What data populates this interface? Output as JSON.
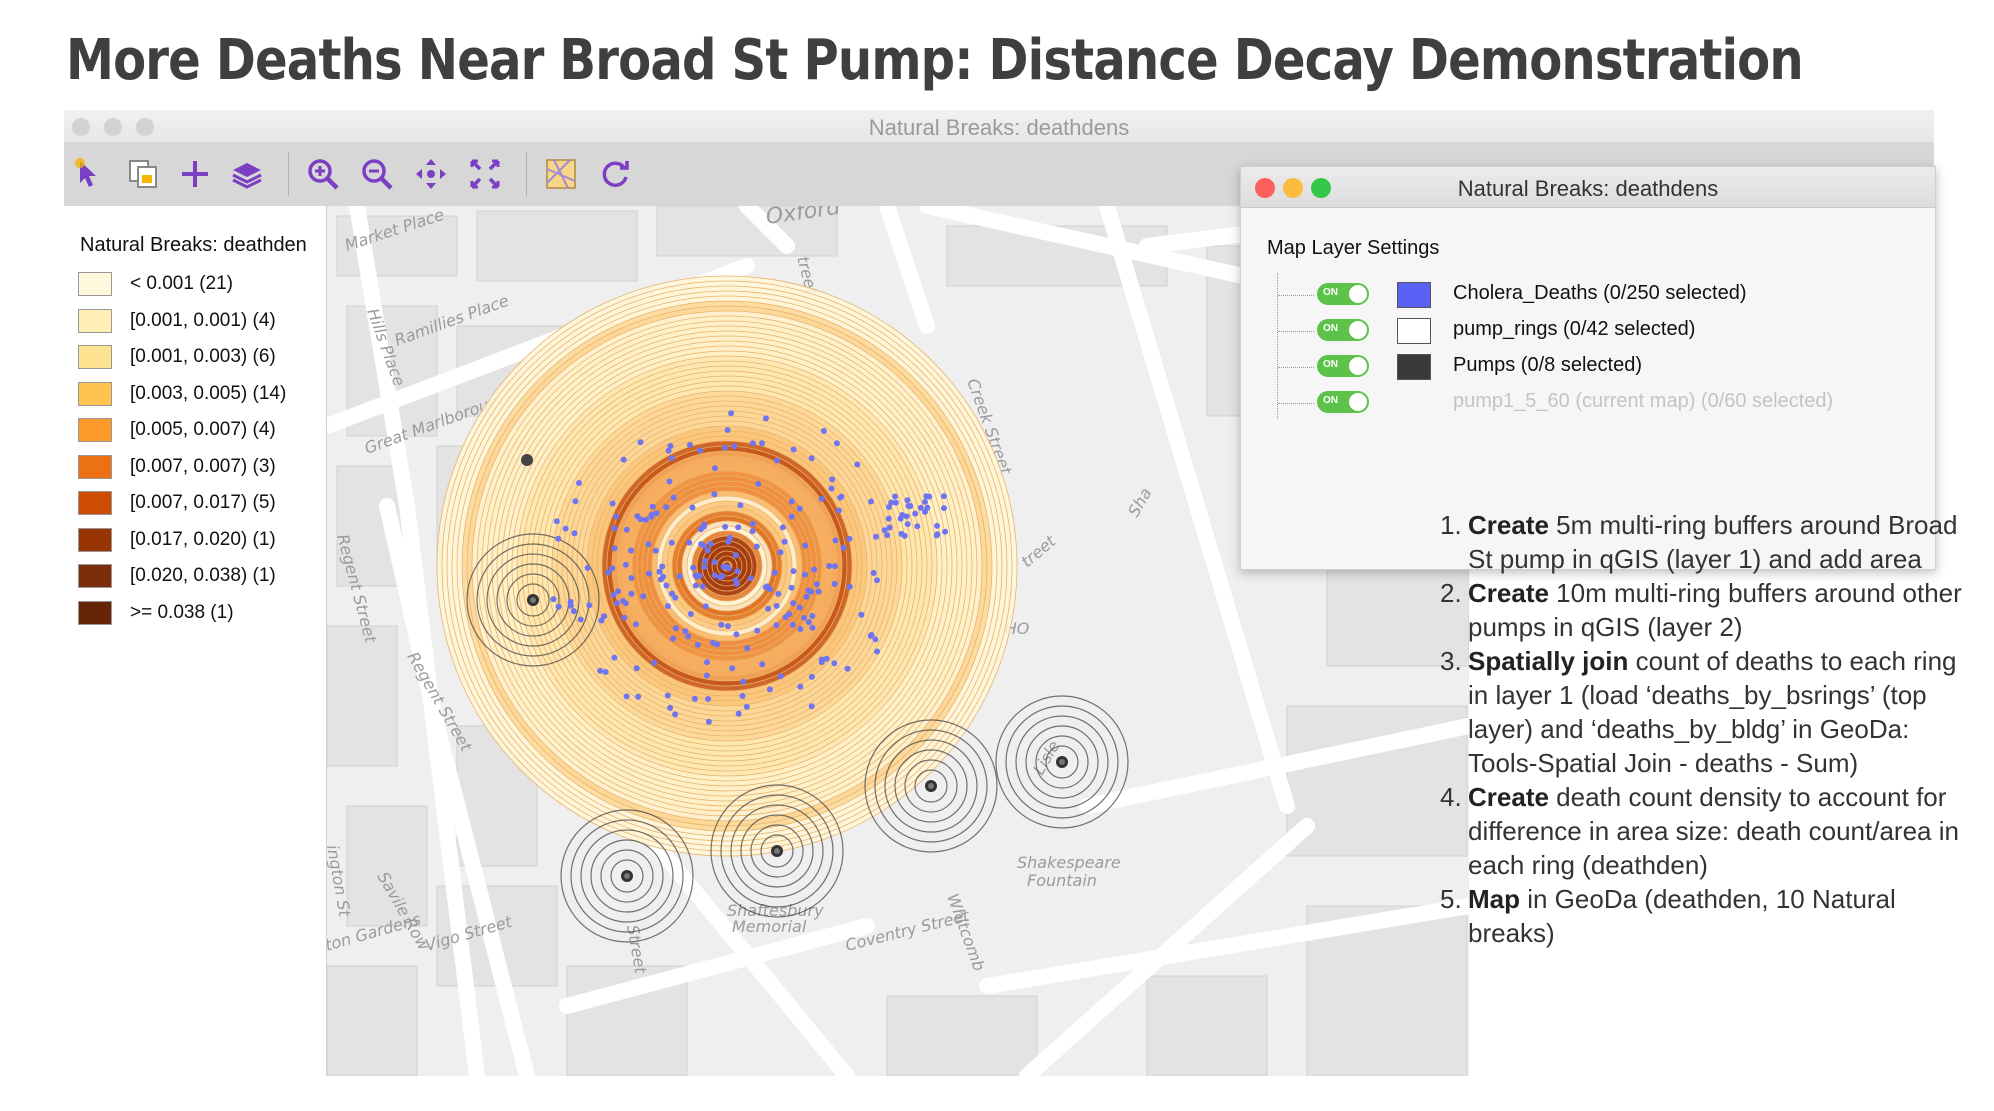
{
  "slide": {
    "title": "More Deaths Near Broad St Pump: Distance Decay Demonstration"
  },
  "window": {
    "title": "Natural Breaks: deathdens"
  },
  "toolbar": {
    "tools": [
      {
        "icon": "select-arrow-icon"
      },
      {
        "icon": "copy-image-icon"
      },
      {
        "icon": "add-layer-plus-icon"
      },
      {
        "icon": "layers-icon"
      },
      {
        "icon": "zoom-in-icon"
      },
      {
        "icon": "zoom-out-icon"
      },
      {
        "icon": "pan-icon"
      },
      {
        "icon": "full-extent-icon"
      },
      {
        "icon": "basemap-icon"
      },
      {
        "icon": "refresh-icon"
      }
    ],
    "icon_color": "#7b3fc4"
  },
  "legend": {
    "title": "Natural Breaks: deathden",
    "items": [
      {
        "label": "< 0.001 (21)",
        "color": "#fff8dc"
      },
      {
        "label": "[0.001, 0.001) (4)",
        "color": "#ffefb5"
      },
      {
        "label": "[0.001, 0.003) (6)",
        "color": "#fee391"
      },
      {
        "label": "[0.003, 0.005) (14)",
        "color": "#fec44f"
      },
      {
        "label": "[0.005, 0.007) (4)",
        "color": "#fb9a29"
      },
      {
        "label": "[0.007, 0.007) (3)",
        "color": "#ec7014"
      },
      {
        "label": "[0.007, 0.017) (5)",
        "color": "#cc4c02"
      },
      {
        "label": "[0.017, 0.020) (1)",
        "color": "#993404"
      },
      {
        "label": "[0.020, 0.038) (1)",
        "color": "#7a2e0a"
      },
      {
        "label": ">= 0.038 (1)",
        "color": "#662506"
      }
    ]
  },
  "map": {
    "street_labels": [
      "Oxford",
      "Market Place",
      "Hills Place",
      "Ramillies Place",
      "Great Marlborough",
      "Regent Street",
      "Regent Street",
      "Creek Street",
      "SOHO",
      "Shakespeare",
      "Fountain",
      "Shaftesbury",
      "Memorial",
      "Coventry Street",
      "Vigo Street",
      "Savile Row",
      "Whitcomb",
      "Lisle",
      "Sha",
      "treet",
      "ton Gardens",
      "ington St",
      "Street",
      "treet"
    ],
    "dot_color": "#6f74f0",
    "ring_color": "#444444"
  },
  "dialog": {
    "title": "Natural Breaks: deathdens",
    "section": "Map Layer Settings",
    "toggle_label": "ON",
    "layers": [
      {
        "name": "Cholera_Deaths (0/250 selected)",
        "swatch": "#5a62f5",
        "dim": false
      },
      {
        "name": "pump_rings (0/42 selected)",
        "swatch": "#ffffff",
        "dim": false
      },
      {
        "name": "Pumps (0/8 selected)",
        "swatch": "#3a3a3a",
        "dim": false
      },
      {
        "name": "pump1_5_60 (current map) (0/60 selected)",
        "swatch": "",
        "dim": true
      }
    ]
  },
  "steps": [
    {
      "num": "1.",
      "bold": "Create",
      "text": " 5m multi-ring buffers around Broad St pump in qGIS (layer 1) and add area"
    },
    {
      "num": "2.",
      "bold": "Create",
      "text": " 10m multi-ring buffers around other pumps in qGIS (layer 2)"
    },
    {
      "num": "3.",
      "bold": "Spatially join",
      "text": " count of deaths to each ring in layer 1 (load ‘deaths_by_bsrings’ (top layer) and ‘deaths_by_bldg’ in GeoDa: Tools-Spatial Join - deaths - Sum)"
    },
    {
      "num": "4.",
      "bold": "Create",
      "text": " death count density to account for difference in area size: death count/area in each ring (deathden)"
    },
    {
      "num": "5.",
      "bold": "Map",
      "text": " in GeoDa (deathden, 10 Natural breaks)"
    }
  ]
}
